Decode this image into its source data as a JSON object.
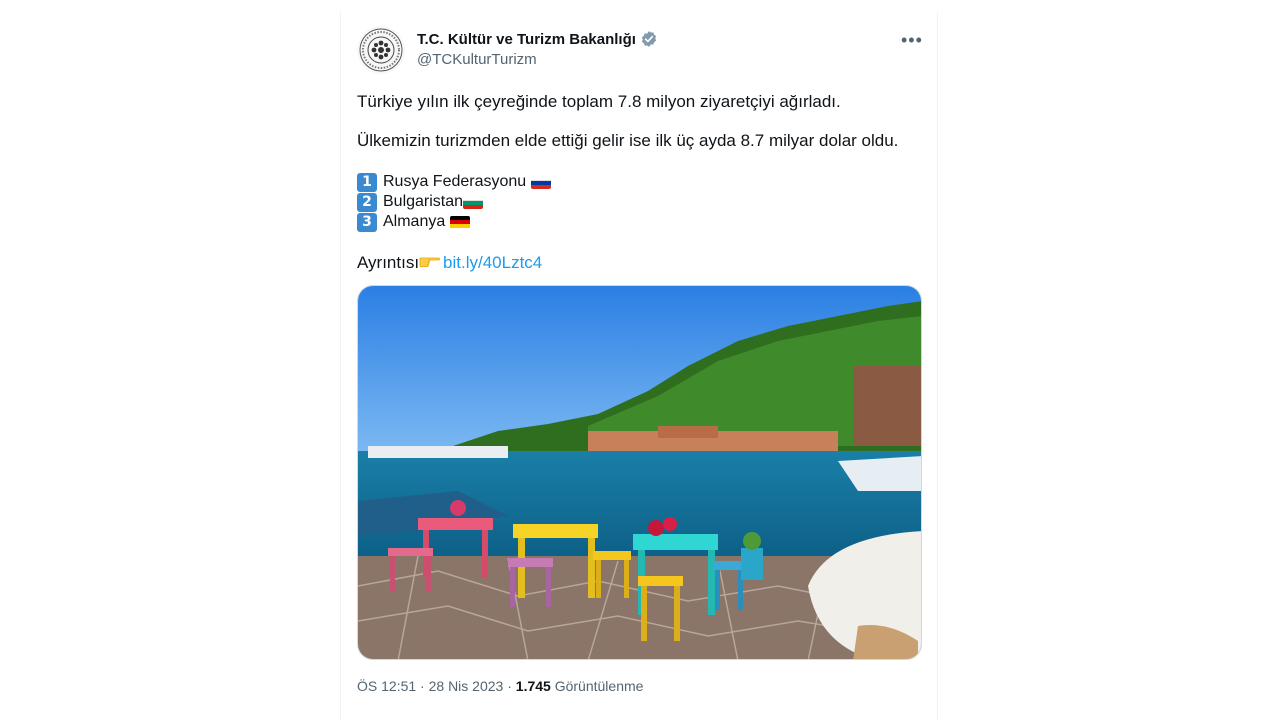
{
  "tweet": {
    "author_name": "T.C. Kültür ve Turizm Bakanlığı",
    "author_handle": "@TCKulturTurizm",
    "more_label": "•••",
    "line1": "Türkiye yılın ilk çeyreğinde toplam 7.8 milyon ziyaretçiyi ağırladı.",
    "line2": "Ülkemizin turizmden elde ettiği gelir ise ilk üç ayda 8.7 milyar dolar oldu.",
    "ranking": [
      {
        "num": "1",
        "country": "Rusya Federasyonu",
        "flag_colors": [
          "#ffffff",
          "#0039a6",
          "#d52b1e"
        ]
      },
      {
        "num": "2",
        "country": "Bulgaristan",
        "flag_colors": [
          "#ffffff",
          "#00966e",
          "#d62612"
        ]
      },
      {
        "num": "3",
        "country": "Almanya",
        "flag_colors": [
          "#000000",
          "#dd0000",
          "#ffce00"
        ]
      }
    ],
    "detail_label": "Ayrıntısı",
    "detail_icon": "pointing-hand-icon",
    "link_text": "bit.ly/40Lztc4",
    "time": "ÖS 12:51",
    "date": "28 Nis 2023",
    "views_count": "1.745",
    "views_label": "Görüntülenme"
  },
  "colors": {
    "link": "#1d9bf0",
    "verified": "#829aab",
    "muted": "#536471",
    "number_badge": "#3a8ad1"
  }
}
